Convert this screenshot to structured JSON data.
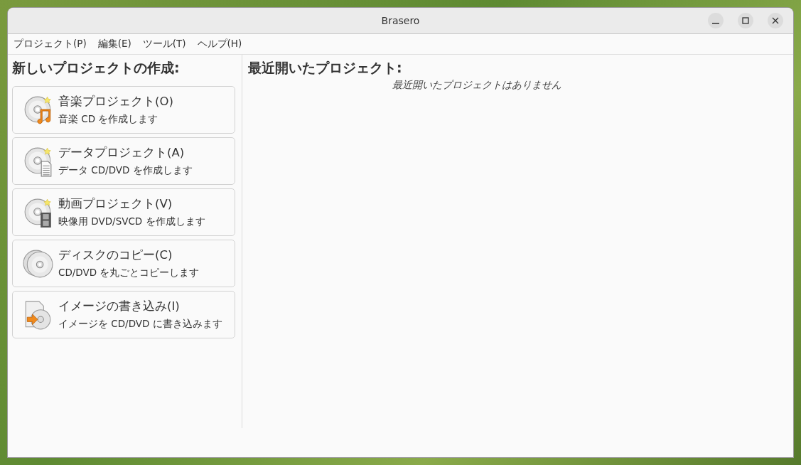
{
  "window": {
    "title": "Brasero"
  },
  "menu": [
    {
      "label": "プロジェクト(P)"
    },
    {
      "label": "編集(E)"
    },
    {
      "label": "ツール(T)"
    },
    {
      "label": "ヘルプ(H)"
    }
  ],
  "new_project": {
    "heading": "新しいプロジェクトの作成:",
    "items": [
      {
        "kind": "music",
        "title": "音楽プロジェクト(O)",
        "description": "音楽 CD を作成します"
      },
      {
        "kind": "data",
        "title": "データプロジェクト(A)",
        "description": "データ CD/DVD を作成します"
      },
      {
        "kind": "video",
        "title": "動画プロジェクト(V)",
        "description": "映像用 DVD/SVCD を作成します"
      },
      {
        "kind": "copy",
        "title": "ディスクのコピー(C)",
        "description": "CD/DVD を丸ごとコピーします"
      },
      {
        "kind": "image",
        "title": "イメージの書き込み(I)",
        "description": "イメージを CD/DVD に書き込みます"
      }
    ]
  },
  "recent": {
    "heading": "最近開いたプロジェクト:",
    "empty_message": "最近開いたプロジェクトはありません"
  }
}
